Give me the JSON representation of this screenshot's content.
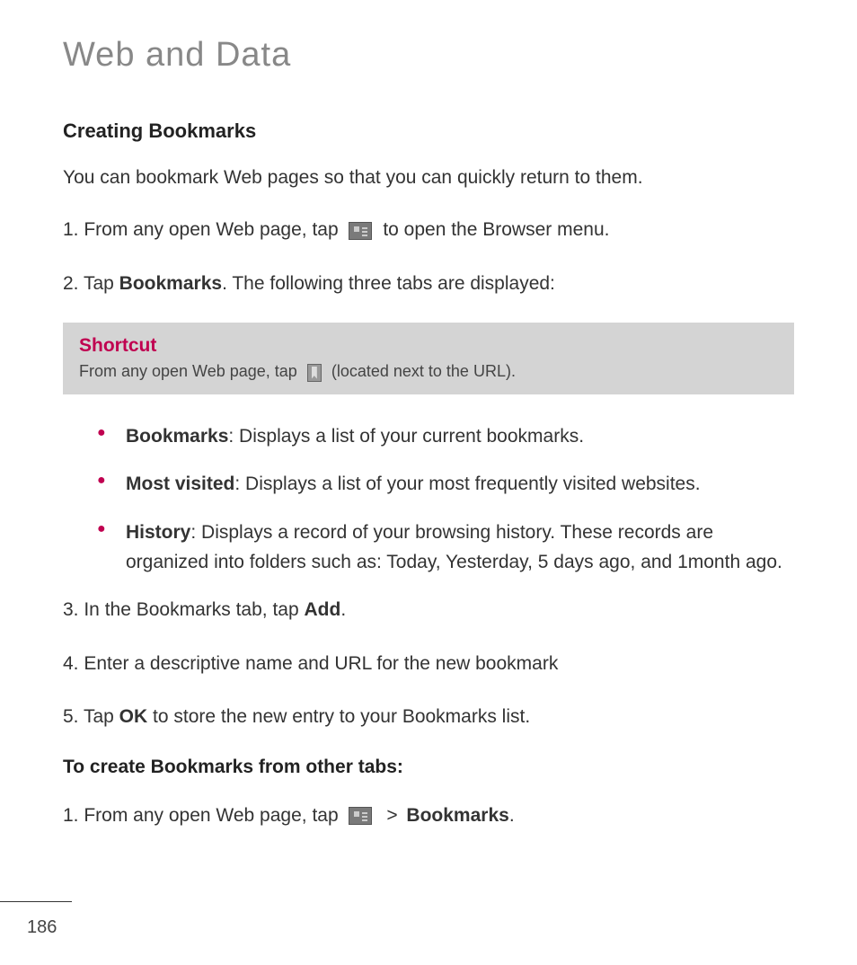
{
  "pageTitle": "Web and Data",
  "section": {
    "heading": "Creating Bookmarks",
    "intro": "You can bookmark Web pages so that you can quickly return to them.",
    "step1_pre": "1. From any open Web page, tap ",
    "step1_post": " to open the Browser menu.",
    "step2_pre": "2. Tap ",
    "step2_bold": "Bookmarks",
    "step2_post": ". The following three tabs are displayed:",
    "shortcut": {
      "title": "Shortcut",
      "pre": "From any open Web page, tap ",
      "post": " (located next to the URL)."
    },
    "bullets": [
      {
        "label": "Bookmarks",
        "desc": ": Displays a list of your current bookmarks."
      },
      {
        "label": "Most visited",
        "desc": ": Displays a list of your most frequently visited websites."
      },
      {
        "label": "History",
        "desc": ": Displays a record of your browsing history. These records are organized into folders such as: Today, Yesterday, 5 days ago, and 1month ago."
      }
    ],
    "step3_pre": "3. In the Bookmarks tab, tap ",
    "step3_bold": "Add",
    "step3_post": ".",
    "step4": "4. Enter a descriptive name and URL for the new bookmark",
    "step5_pre": "5. Tap ",
    "step5_bold": "OK",
    "step5_post": " to store the new entry to your Bookmarks list.",
    "subHeading": "To create Bookmarks from other tabs:",
    "otherStep1_pre": "1. From any open Web page, tap ",
    "otherStep1_gt": " > ",
    "otherStep1_bold": "Bookmarks",
    "otherStep1_post": "."
  },
  "pageNumber": "186"
}
